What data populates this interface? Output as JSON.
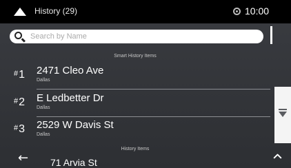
{
  "header": {
    "title": "History (29)",
    "time": "10:00"
  },
  "search": {
    "placeholder": "Search by Name"
  },
  "sections": {
    "smart_label": "Smart History Items",
    "history_label": "History Items"
  },
  "smart_items": [
    {
      "rank_prefix": "#",
      "rank": "1",
      "street": "2471 Cleo Ave",
      "city": "Dallas"
    },
    {
      "rank_prefix": "#",
      "rank": "2",
      "street": "E Ledbetter Dr",
      "city": "Dallas"
    },
    {
      "rank_prefix": "#",
      "rank": "3",
      "street": "2529 W Davis St",
      "city": "Dallas"
    }
  ],
  "history_items": [
    {
      "street": "71 Arvia St"
    }
  ],
  "icons": {
    "up": "triangle-up-icon",
    "gps": "gps-status-icon",
    "search": "search-icon",
    "scroll_down": "scroll-down-icon",
    "back": "back-arrow-icon",
    "scroll_up": "chevron-up-icon"
  },
  "colors": {
    "topbar": "#000000",
    "background": "#2f3136",
    "text": "#ffffff",
    "secondary_text": "#c9c9c9"
  }
}
